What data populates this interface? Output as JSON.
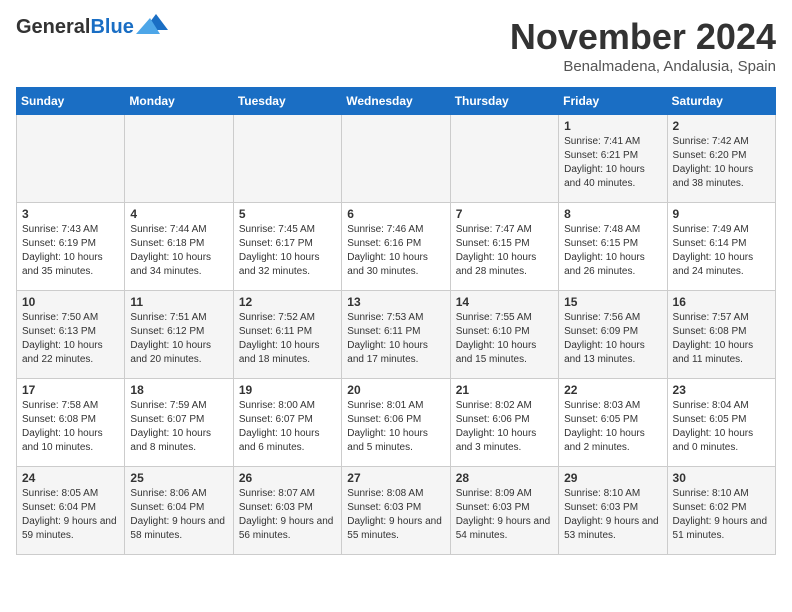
{
  "header": {
    "logo_general": "General",
    "logo_blue": "Blue",
    "month": "November 2024",
    "location": "Benalmadena, Andalusia, Spain"
  },
  "days_of_week": [
    "Sunday",
    "Monday",
    "Tuesday",
    "Wednesday",
    "Thursday",
    "Friday",
    "Saturday"
  ],
  "weeks": [
    [
      {
        "day": "",
        "info": ""
      },
      {
        "day": "",
        "info": ""
      },
      {
        "day": "",
        "info": ""
      },
      {
        "day": "",
        "info": ""
      },
      {
        "day": "",
        "info": ""
      },
      {
        "day": "1",
        "info": "Sunrise: 7:41 AM\nSunset: 6:21 PM\nDaylight: 10 hours and 40 minutes."
      },
      {
        "day": "2",
        "info": "Sunrise: 7:42 AM\nSunset: 6:20 PM\nDaylight: 10 hours and 38 minutes."
      }
    ],
    [
      {
        "day": "3",
        "info": "Sunrise: 7:43 AM\nSunset: 6:19 PM\nDaylight: 10 hours and 35 minutes."
      },
      {
        "day": "4",
        "info": "Sunrise: 7:44 AM\nSunset: 6:18 PM\nDaylight: 10 hours and 34 minutes."
      },
      {
        "day": "5",
        "info": "Sunrise: 7:45 AM\nSunset: 6:17 PM\nDaylight: 10 hours and 32 minutes."
      },
      {
        "day": "6",
        "info": "Sunrise: 7:46 AM\nSunset: 6:16 PM\nDaylight: 10 hours and 30 minutes."
      },
      {
        "day": "7",
        "info": "Sunrise: 7:47 AM\nSunset: 6:15 PM\nDaylight: 10 hours and 28 minutes."
      },
      {
        "day": "8",
        "info": "Sunrise: 7:48 AM\nSunset: 6:15 PM\nDaylight: 10 hours and 26 minutes."
      },
      {
        "day": "9",
        "info": "Sunrise: 7:49 AM\nSunset: 6:14 PM\nDaylight: 10 hours and 24 minutes."
      }
    ],
    [
      {
        "day": "10",
        "info": "Sunrise: 7:50 AM\nSunset: 6:13 PM\nDaylight: 10 hours and 22 minutes."
      },
      {
        "day": "11",
        "info": "Sunrise: 7:51 AM\nSunset: 6:12 PM\nDaylight: 10 hours and 20 minutes."
      },
      {
        "day": "12",
        "info": "Sunrise: 7:52 AM\nSunset: 6:11 PM\nDaylight: 10 hours and 18 minutes."
      },
      {
        "day": "13",
        "info": "Sunrise: 7:53 AM\nSunset: 6:11 PM\nDaylight: 10 hours and 17 minutes."
      },
      {
        "day": "14",
        "info": "Sunrise: 7:55 AM\nSunset: 6:10 PM\nDaylight: 10 hours and 15 minutes."
      },
      {
        "day": "15",
        "info": "Sunrise: 7:56 AM\nSunset: 6:09 PM\nDaylight: 10 hours and 13 minutes."
      },
      {
        "day": "16",
        "info": "Sunrise: 7:57 AM\nSunset: 6:08 PM\nDaylight: 10 hours and 11 minutes."
      }
    ],
    [
      {
        "day": "17",
        "info": "Sunrise: 7:58 AM\nSunset: 6:08 PM\nDaylight: 10 hours and 10 minutes."
      },
      {
        "day": "18",
        "info": "Sunrise: 7:59 AM\nSunset: 6:07 PM\nDaylight: 10 hours and 8 minutes."
      },
      {
        "day": "19",
        "info": "Sunrise: 8:00 AM\nSunset: 6:07 PM\nDaylight: 10 hours and 6 minutes."
      },
      {
        "day": "20",
        "info": "Sunrise: 8:01 AM\nSunset: 6:06 PM\nDaylight: 10 hours and 5 minutes."
      },
      {
        "day": "21",
        "info": "Sunrise: 8:02 AM\nSunset: 6:06 PM\nDaylight: 10 hours and 3 minutes."
      },
      {
        "day": "22",
        "info": "Sunrise: 8:03 AM\nSunset: 6:05 PM\nDaylight: 10 hours and 2 minutes."
      },
      {
        "day": "23",
        "info": "Sunrise: 8:04 AM\nSunset: 6:05 PM\nDaylight: 10 hours and 0 minutes."
      }
    ],
    [
      {
        "day": "24",
        "info": "Sunrise: 8:05 AM\nSunset: 6:04 PM\nDaylight: 9 hours and 59 minutes."
      },
      {
        "day": "25",
        "info": "Sunrise: 8:06 AM\nSunset: 6:04 PM\nDaylight: 9 hours and 58 minutes."
      },
      {
        "day": "26",
        "info": "Sunrise: 8:07 AM\nSunset: 6:03 PM\nDaylight: 9 hours and 56 minutes."
      },
      {
        "day": "27",
        "info": "Sunrise: 8:08 AM\nSunset: 6:03 PM\nDaylight: 9 hours and 55 minutes."
      },
      {
        "day": "28",
        "info": "Sunrise: 8:09 AM\nSunset: 6:03 PM\nDaylight: 9 hours and 54 minutes."
      },
      {
        "day": "29",
        "info": "Sunrise: 8:10 AM\nSunset: 6:03 PM\nDaylight: 9 hours and 53 minutes."
      },
      {
        "day": "30",
        "info": "Sunrise: 8:10 AM\nSunset: 6:02 PM\nDaylight: 9 hours and 51 minutes."
      }
    ]
  ]
}
